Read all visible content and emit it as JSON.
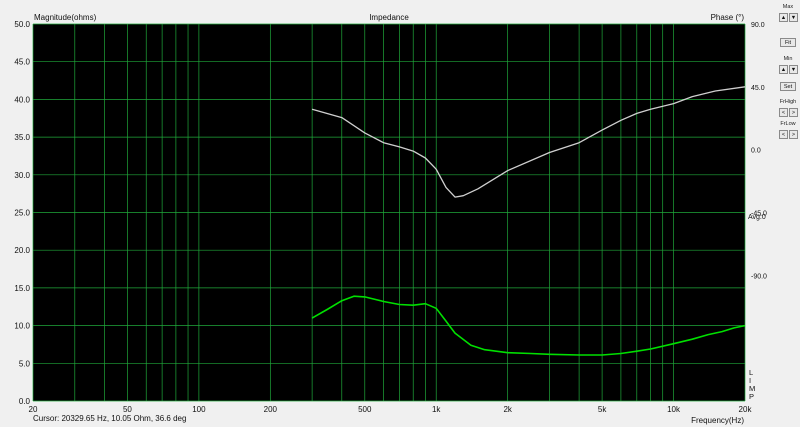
{
  "chart_data": {
    "type": "line",
    "title": "Impedance",
    "ylabel": "Magnitude(ohms)",
    "y2label": "Phase (°)",
    "xlabel": "Frequency(Hz)",
    "xscale": "log",
    "xlim": [
      20,
      20000
    ],
    "ylim": [
      0,
      50
    ],
    "y2lim": [
      -180,
      90
    ],
    "x_ticks": [
      20,
      50,
      100,
      200,
      500,
      1000,
      2000,
      5000,
      10000,
      20000
    ],
    "x_tick_labels": [
      "20",
      "50",
      "100",
      "200",
      "500",
      "1k",
      "2k",
      "5k",
      "10k",
      "20k"
    ],
    "y_ticks": [
      0,
      5,
      10,
      15,
      20,
      25,
      30,
      35,
      40,
      45,
      50
    ],
    "y_tick_labels": [
      "0.0",
      "5.0",
      "10.0",
      "15.0",
      "20.0",
      "25.0",
      "30.0",
      "35.0",
      "40.0",
      "45.0",
      "50.0"
    ],
    "y2_ticks": [
      90,
      45,
      0,
      -45,
      -90
    ],
    "y2_tick_labels": [
      "90.0",
      "45.0",
      "0.0",
      "-45.0",
      "-90.0"
    ],
    "grid": true,
    "annotation": "Avg:0",
    "right_letters": [
      "L",
      "I",
      "M",
      "P"
    ],
    "series": [
      {
        "axis": "left",
        "color": "#00e000",
        "points": [
          [
            300,
            11.0
          ],
          [
            350,
            12.2
          ],
          [
            400,
            13.3
          ],
          [
            450,
            13.9
          ],
          [
            500,
            13.8
          ],
          [
            600,
            13.2
          ],
          [
            700,
            12.8
          ],
          [
            800,
            12.7
          ],
          [
            900,
            12.9
          ],
          [
            1000,
            12.3
          ],
          [
            1100,
            10.6
          ],
          [
            1200,
            9.0
          ],
          [
            1400,
            7.4
          ],
          [
            1600,
            6.8
          ],
          [
            2000,
            6.4
          ],
          [
            2500,
            6.3
          ],
          [
            3000,
            6.2
          ],
          [
            4000,
            6.1
          ],
          [
            5000,
            6.1
          ],
          [
            6000,
            6.3
          ],
          [
            7000,
            6.6
          ],
          [
            8000,
            6.9
          ],
          [
            10000,
            7.6
          ],
          [
            12000,
            8.2
          ],
          [
            14000,
            8.8
          ],
          [
            16000,
            9.2
          ],
          [
            18000,
            9.7
          ],
          [
            20000,
            10.0
          ]
        ]
      },
      {
        "axis": "right",
        "color": "#cfcfcf",
        "points": [
          [
            300,
            29
          ],
          [
            400,
            23
          ],
          [
            500,
            12
          ],
          [
            600,
            5
          ],
          [
            700,
            2
          ],
          [
            800,
            -1
          ],
          [
            900,
            -6
          ],
          [
            1000,
            -14
          ],
          [
            1100,
            -27
          ],
          [
            1200,
            -34
          ],
          [
            1300,
            -33
          ],
          [
            1500,
            -28
          ],
          [
            2000,
            -15
          ],
          [
            3000,
            -2
          ],
          [
            4000,
            5
          ],
          [
            5000,
            14
          ],
          [
            6000,
            21
          ],
          [
            7000,
            26
          ],
          [
            8000,
            29
          ],
          [
            10000,
            33
          ],
          [
            12000,
            38
          ],
          [
            15000,
            42
          ],
          [
            20000,
            45
          ]
        ]
      }
    ]
  },
  "cursor_readout": "Cursor: 20329.65 Hz, 10.05 Ohm, 36.6 deg",
  "side_panel": {
    "max_label": "Max",
    "fit_label": "Fit",
    "min_label": "Min",
    "set_label": "Set",
    "frhigh_label": "FrHigh",
    "frlow_label": "FrLow",
    "up_arrow": "▲",
    "down_arrow": "▼",
    "left_arrow": "<",
    "right_arrow": ">"
  },
  "colors": {
    "plot_background": "#000000",
    "grid": "#1fa83a",
    "window_background": "#f0f0f0"
  }
}
